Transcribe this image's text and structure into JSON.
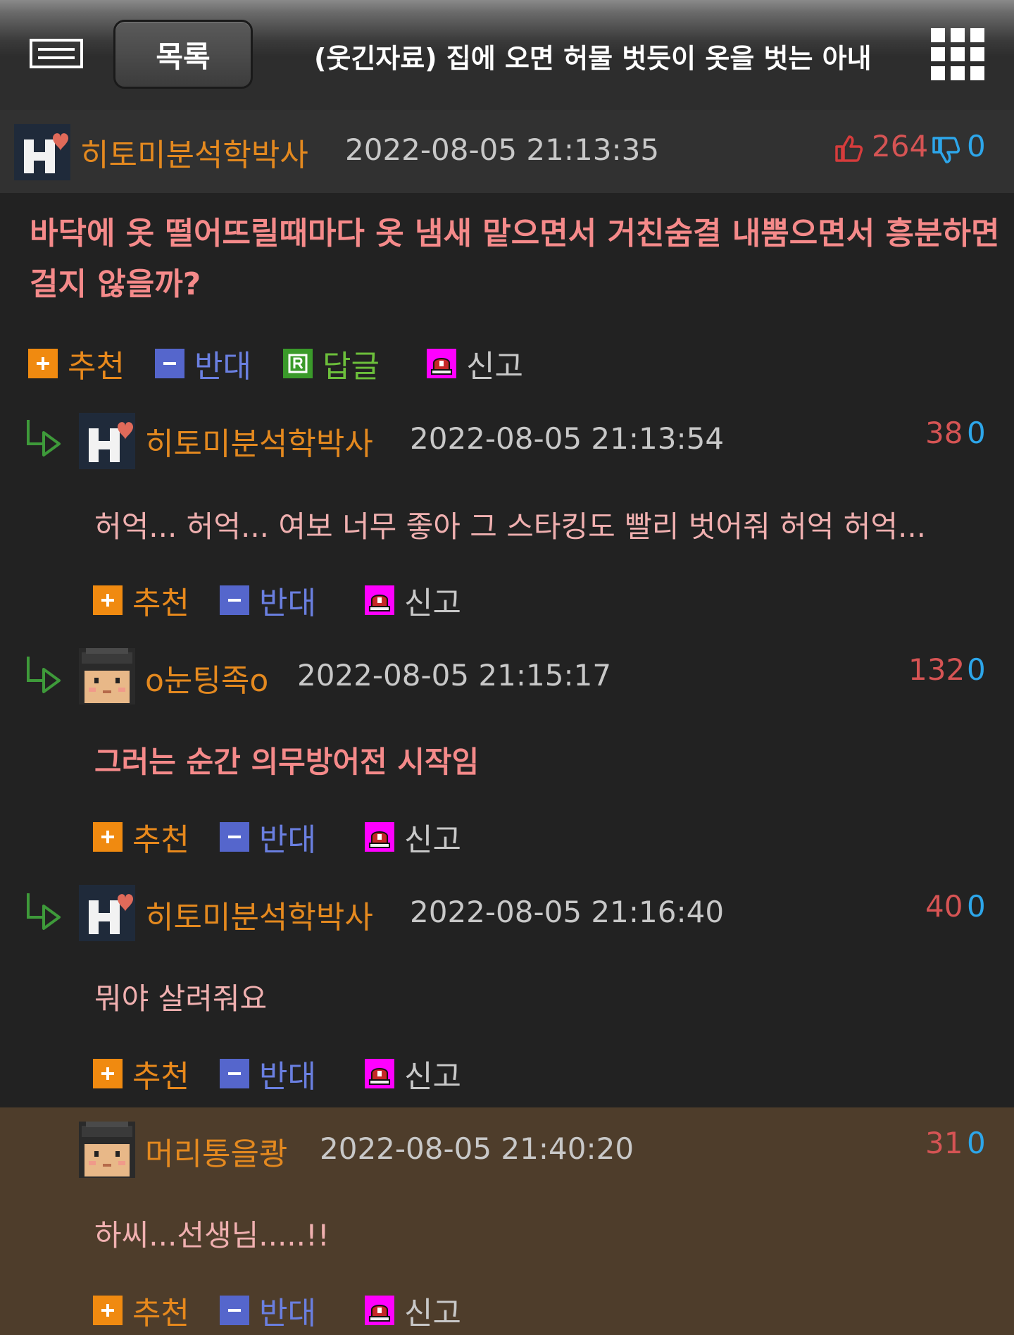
{
  "header": {
    "list_label": "목록",
    "title": "(웃긴자료) 집에 오면 허물 벗듯이 옷을 벗는 아내",
    "menu_icon": "hamburger-icon",
    "grid_icon": "grid-icon"
  },
  "post": {
    "nickname": "히토미분석학박사",
    "date": "2022-08-05 21:13:35",
    "up": "264",
    "down": "0",
    "body": "바닥에 옷 떨어뜨릴때마다 옷 냄새 맡으면서 거친숨결 내뿜으면서 흥분하면 걸지 않을까?"
  },
  "actions": {
    "recommend": "추천",
    "oppose": "반대",
    "reply": "답글",
    "report": "신고"
  },
  "comments": [
    {
      "nickname": "히토미분석학박사",
      "date": "2022-08-05 21:13:54",
      "up": "38",
      "down": "0",
      "body": "허억... 허억... 여보 너무 좋아 그 스타킹도 빨리 벗어줘 허억 허억..."
    },
    {
      "nickname": "o눈팅족o",
      "date": "2022-08-05 21:15:17",
      "up": "132",
      "down": "0",
      "body": "그러는 순간 의무방어전 시작임"
    },
    {
      "nickname": "히토미분석학박사",
      "date": "2022-08-05 21:16:40",
      "up": "40",
      "down": "0",
      "body": "뭐야 살려줘요"
    },
    {
      "nickname": "머리통을쾅",
      "date": "2022-08-05 21:40:20",
      "up": "31",
      "down": "0",
      "body": "하씨...선생님.....!!"
    }
  ],
  "colors": {
    "background": "#222222",
    "nickname": "#e4891f",
    "upvote": "#d65454",
    "downvote": "#2da6ea",
    "highlight_bg": "#4e3d2b"
  }
}
